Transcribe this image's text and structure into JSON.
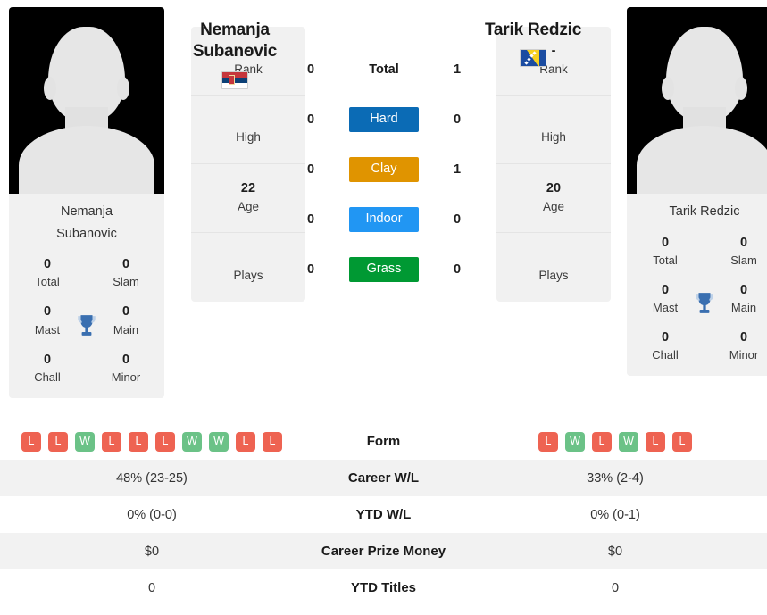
{
  "players": {
    "left": {
      "name": "Nemanja Subanovic",
      "name_line1": "Nemanja",
      "name_line2": "Subanovic",
      "photo_caption_line1": "Nemanja",
      "photo_caption_line2": "Subanovic",
      "flag": "serbia-flag",
      "info": [
        {
          "value": "-",
          "label": "Rank"
        },
        {
          "value": "",
          "label": "High"
        },
        {
          "value": "22",
          "label": "Age"
        },
        {
          "value": "",
          "label": "Plays"
        }
      ],
      "titles": [
        {
          "value": "0",
          "label": "Total"
        },
        {
          "value": "0",
          "label": "Slam"
        },
        {
          "value": "0",
          "label": "Mast"
        },
        {
          "value": "0",
          "label": "Main"
        },
        {
          "value": "0",
          "label": "Chall"
        },
        {
          "value": "0",
          "label": "Minor"
        }
      ],
      "form": [
        "L",
        "L",
        "W",
        "L",
        "L",
        "L",
        "W",
        "W",
        "L",
        "L"
      ],
      "career_wl": "48% (23-25)",
      "ytd_wl": "0% (0-0)",
      "career_prize_money": "$0",
      "ytd_titles": "0"
    },
    "right": {
      "name": "Tarik Redzic",
      "name_line1": "Tarik Redzic",
      "name_line2": "",
      "photo_caption_line1": "Tarik Redzic",
      "photo_caption_line2": "",
      "flag": "bosnia-herzegovina-flag",
      "info": [
        {
          "value": "-",
          "label": "Rank"
        },
        {
          "value": "",
          "label": "High"
        },
        {
          "value": "20",
          "label": "Age"
        },
        {
          "value": "",
          "label": "Plays"
        }
      ],
      "titles": [
        {
          "value": "0",
          "label": "Total"
        },
        {
          "value": "0",
          "label": "Slam"
        },
        {
          "value": "0",
          "label": "Mast"
        },
        {
          "value": "0",
          "label": "Main"
        },
        {
          "value": "0",
          "label": "Chall"
        },
        {
          "value": "0",
          "label": "Minor"
        }
      ],
      "form": [
        "L",
        "W",
        "L",
        "W",
        "L",
        "L"
      ],
      "career_wl": "33% (2-4)",
      "ytd_wl": "0% (0-1)",
      "career_prize_money": "$0",
      "ytd_titles": "0"
    }
  },
  "surfaces": [
    {
      "label": "Total",
      "left": "0",
      "right": "1",
      "color": "",
      "plain": true
    },
    {
      "label": "Hard",
      "left": "0",
      "right": "0",
      "color": "#0B6BB5",
      "plain": false
    },
    {
      "label": "Clay",
      "left": "0",
      "right": "1",
      "color": "#E09400",
      "plain": false
    },
    {
      "label": "Indoor",
      "left": "0",
      "right": "0",
      "color": "#2196F3",
      "plain": false
    },
    {
      "label": "Grass",
      "left": "0",
      "right": "0",
      "color": "#009933",
      "plain": false
    }
  ],
  "table": {
    "rows": [
      {
        "label": "Form",
        "kind": "form",
        "shade": false
      },
      {
        "label": "Career W/L",
        "kind": "value",
        "shade": true,
        "left": "48% (23-25)",
        "right": "33% (2-4)"
      },
      {
        "label": "YTD W/L",
        "kind": "value",
        "shade": false,
        "left": "0% (0-0)",
        "right": "0% (0-1)"
      },
      {
        "label": "Career Prize Money",
        "kind": "value",
        "shade": true,
        "left": "$0",
        "right": "$0"
      },
      {
        "label": "YTD Titles",
        "kind": "value",
        "shade": false,
        "left": "0",
        "right": "0"
      }
    ]
  },
  "colors": {
    "win_badge": "#6BC287",
    "loss_badge": "#EE6352",
    "card_bg": "#F1F1F1",
    "row_shade": "#F2F2F2",
    "trophy": "#3A6FB0"
  }
}
